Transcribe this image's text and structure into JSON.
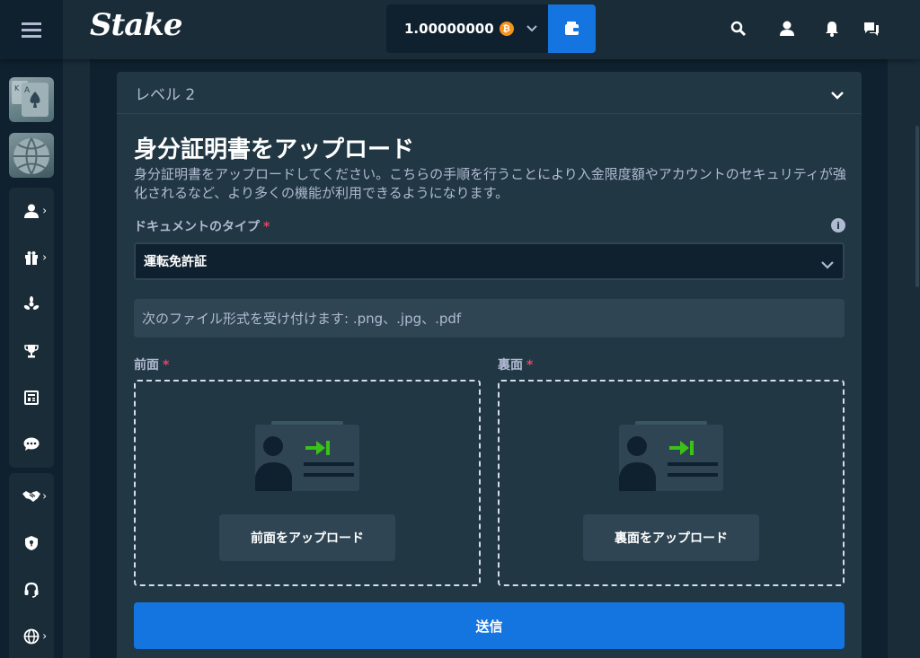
{
  "header": {
    "logo": "Stake",
    "balance": "1.00000000",
    "currency_symbol": "₿",
    "icons": [
      "search-icon",
      "user-icon",
      "bell-icon",
      "chat-icon"
    ]
  },
  "sidebar": {
    "games": [
      {
        "name": "casino-thumbnail",
        "glyph": "K A"
      },
      {
        "name": "sports-thumbnail"
      }
    ],
    "group1": [
      "user-icon",
      "gift-icon",
      "affiliate-icon",
      "trophy-icon",
      "blog-icon",
      "forum-icon"
    ],
    "group2": [
      "handshake-icon",
      "shield-icon",
      "headset-icon",
      "globe-icon"
    ]
  },
  "panel": {
    "level": "レベル 2",
    "title": "身分証明書をアップロード",
    "description": "身分証明書をアップロードしてください。こちらの手順を行うことにより入金限度額やアカウントのセキュリティが強化されるなど、より多くの機能が利用できるようになります。",
    "doc_type_label": "ドキュメントのタイプ",
    "required_mark": "*",
    "doc_type_value": "運転免許証",
    "accepted_formats": "次のファイル形式を受け付けます: .png、.jpg、.pdf",
    "front_label": "前面",
    "back_label": "裏面",
    "front_button": "前面をアップロード",
    "back_button": "裏面をアップロード",
    "submit": "送信"
  },
  "colors": {
    "background": "#0f212e",
    "panel": "#213743",
    "accent": "#1475e1",
    "required": "#ed4163",
    "bitcoin": "#f7931a",
    "id_arrow": "#3bc117"
  }
}
